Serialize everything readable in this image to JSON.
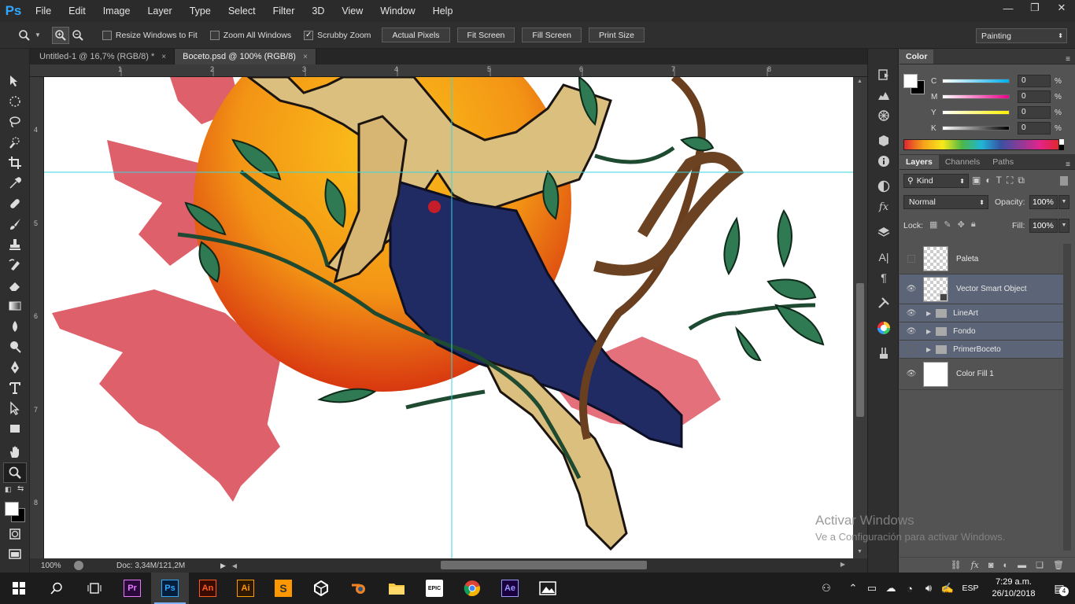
{
  "app": {
    "logo": "Ps"
  },
  "menu": [
    "File",
    "Edit",
    "Image",
    "Layer",
    "Type",
    "Select",
    "Filter",
    "3D",
    "View",
    "Window",
    "Help"
  ],
  "window_buttons": {
    "minimize": "—",
    "restore": "❐",
    "close": "✕"
  },
  "options": {
    "resize_windows": "Resize Windows to Fit",
    "zoom_all": "Zoom All Windows",
    "scrubby_zoom": "Scrubby Zoom",
    "actual_pixels": "Actual Pixels",
    "fit_screen": "Fit Screen",
    "fill_screen": "Fill Screen",
    "print_size": "Print Size",
    "workspace": "Painting"
  },
  "tabs": [
    {
      "label": "Untitled-1 @ 16,7% (RGB/8) *",
      "close": "×"
    },
    {
      "label": "Boceto.psd @ 100% (RGB/8)",
      "close": "×"
    }
  ],
  "ruler_top": [
    "1",
    "2",
    "3",
    "4",
    "5",
    "6",
    "7",
    "8"
  ],
  "ruler_left": [
    "4",
    "5",
    "6",
    "7",
    "8"
  ],
  "status": {
    "zoom": "100%",
    "doc": "Doc: 3,34M/121,2M"
  },
  "color_panel": {
    "title": "Color",
    "sliders": [
      {
        "label": "C",
        "value": "0",
        "unit": "%"
      },
      {
        "label": "M",
        "value": "0",
        "unit": "%"
      },
      {
        "label": "Y",
        "value": "0",
        "unit": "%"
      },
      {
        "label": "K",
        "value": "0",
        "unit": "%"
      }
    ]
  },
  "layers_panel": {
    "tabs": [
      "Layers",
      "Channels",
      "Paths"
    ],
    "kind": "Kind",
    "blend": "Normal",
    "opacity_label": "Opacity:",
    "opacity": "100%",
    "lock_label": "Lock:",
    "fill_label": "Fill:",
    "fill": "100%",
    "layers": [
      {
        "name": "Paleta",
        "visible": false,
        "type": "layer"
      },
      {
        "name": "Vector Smart Object",
        "visible": true,
        "type": "smart"
      },
      {
        "name": "LineArt",
        "visible": true,
        "type": "group"
      },
      {
        "name": "Fondo",
        "visible": true,
        "type": "group"
      },
      {
        "name": "PrimerBoceto",
        "visible": false,
        "type": "group"
      },
      {
        "name": "Color Fill 1",
        "visible": true,
        "type": "fill"
      }
    ]
  },
  "watermark": {
    "title": "Activar Windows",
    "subtitle": "Ve a Configuración para activar Windows."
  },
  "taskbar": {
    "apps": [
      "Pr",
      "Ps",
      "An",
      "Ai",
      "",
      "",
      "",
      "",
      "EPIC",
      "",
      "Ae",
      ""
    ],
    "lang": "ESP",
    "time": "7:29 a.m.",
    "date": "26/10/2018",
    "notifications": "4"
  }
}
